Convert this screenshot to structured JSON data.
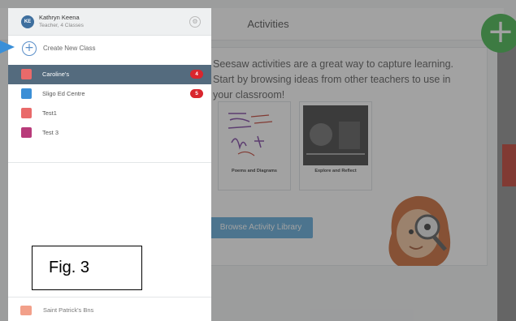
{
  "app": {
    "header_title": "Activities",
    "intro_text": "Seesaw activities are a great way to capture learning. Start by browsing ideas from other teachers to use in your classroom!",
    "tiles": [
      {
        "label": "Poems and Diagrams"
      },
      {
        "label": "Explore and Reflect"
      }
    ],
    "library_button": "Browse Activity Library",
    "fab_symbol": "+"
  },
  "drawer": {
    "user": {
      "initials": "KE",
      "name": "Kathryn Keena",
      "subtitle": "Teacher, 4 Classes"
    },
    "gear_icon": "gear-icon",
    "create_label": "Create New Class",
    "classes": [
      {
        "label": "Caroline's",
        "badge": "4",
        "icon_color": "#e96a6a",
        "selected": true
      },
      {
        "label": "Sligo Ed Centre",
        "badge": "5",
        "icon_color": "#3b8fd6",
        "selected": false
      },
      {
        "label": "Test1",
        "badge": "",
        "icon_color": "#e96a6a",
        "selected": false
      },
      {
        "label": "Test 3",
        "badge": "",
        "icon_color": "#b83b7a",
        "selected": false
      }
    ],
    "figure_label": "Fig. 3",
    "school_label": "Saint Patrick's Bns"
  },
  "colors": {
    "selected_bg": "#546b7e",
    "badge_red": "#d9262e",
    "fab_green": "#3fb448",
    "accent_blue": "#5a8fc9"
  }
}
